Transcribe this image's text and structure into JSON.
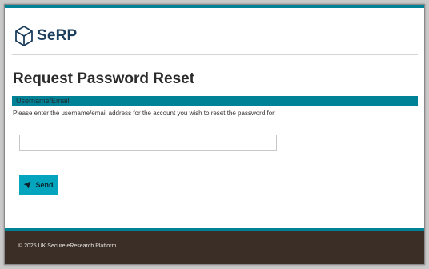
{
  "header": {
    "logo_text": "SeRP"
  },
  "main": {
    "title": "Request Password Reset",
    "field_label": "Username/Email",
    "instructions": "Please enter the username/email address for the account you wish to reset the password for",
    "username_value": "",
    "username_placeholder": "",
    "send_label": "Send"
  },
  "footer": {
    "copyright": "© 2025 UK Secure eResearch Platform"
  },
  "icons": {
    "logo": "cube-logo-icon",
    "send": "paper-plane-icon"
  },
  "colors": {
    "accent": "#008296",
    "button": "#02a5bd",
    "footer_bg": "#3a2e26",
    "brand_text": "#1d3f5e"
  }
}
